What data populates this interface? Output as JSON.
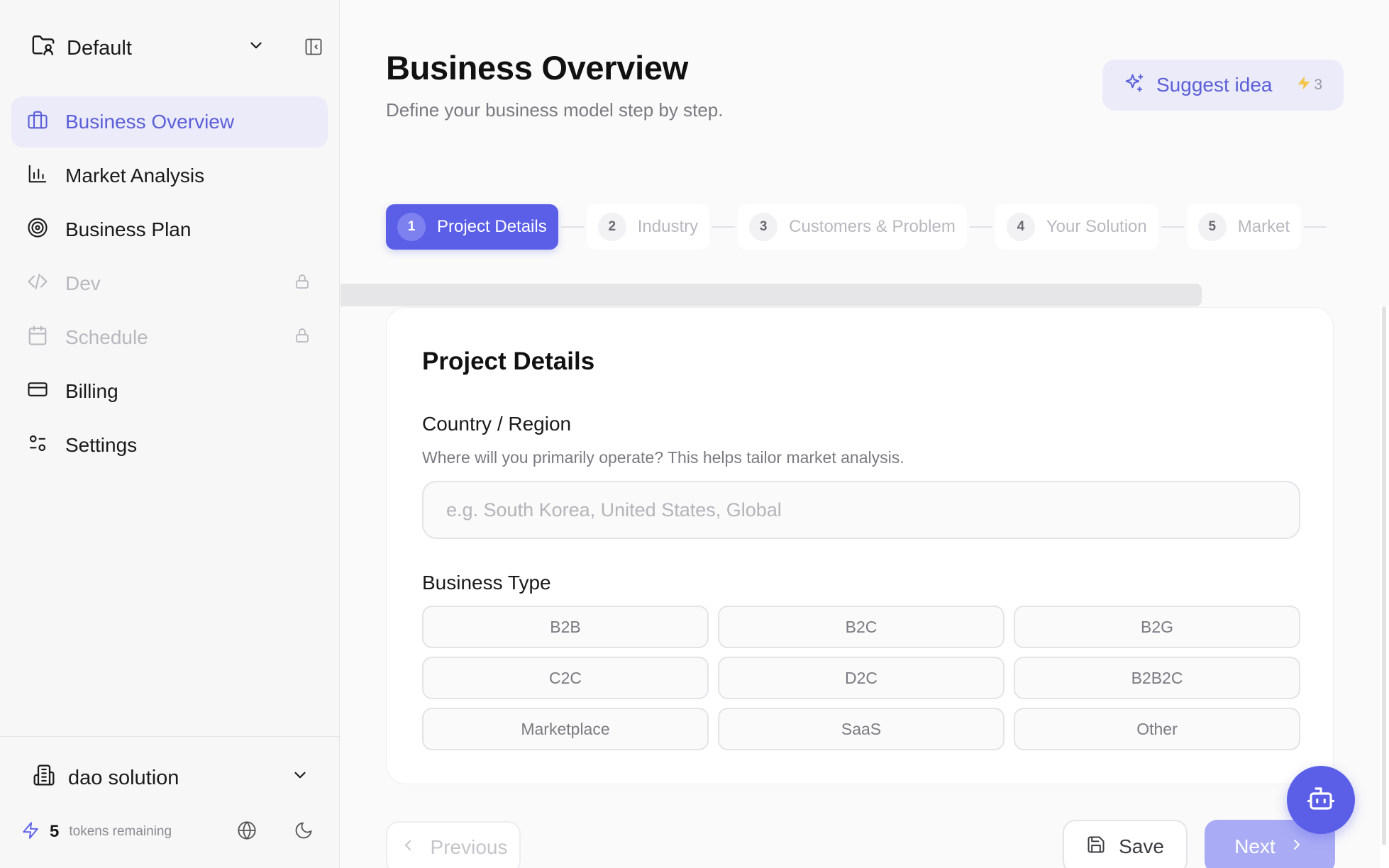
{
  "sidebar": {
    "workspace": "Default",
    "items": [
      {
        "label": "Business Overview",
        "icon": "briefcase-icon",
        "state": "active"
      },
      {
        "label": "Market Analysis",
        "icon": "bar-chart-icon",
        "state": "normal"
      },
      {
        "label": "Business Plan",
        "icon": "target-icon",
        "state": "normal"
      },
      {
        "label": "Dev",
        "icon": "code-icon",
        "state": "locked"
      },
      {
        "label": "Schedule",
        "icon": "calendar-icon",
        "state": "locked"
      },
      {
        "label": "Billing",
        "icon": "credit-card-icon",
        "state": "normal"
      },
      {
        "label": "Settings",
        "icon": "sliders-icon",
        "state": "normal"
      }
    ],
    "org": "dao solution",
    "tokens_count": "5",
    "tokens_label": "tokens remaining"
  },
  "header": {
    "title": "Business Overview",
    "subtitle": "Define your business model step by step.",
    "suggest_label": "Suggest idea",
    "suggest_count": "3"
  },
  "steps": [
    {
      "num": "1",
      "label": "Project Details",
      "active": true
    },
    {
      "num": "2",
      "label": "Industry",
      "active": false
    },
    {
      "num": "3",
      "label": "Customers & Problem",
      "active": false
    },
    {
      "num": "4",
      "label": "Your Solution",
      "active": false
    },
    {
      "num": "5",
      "label": "Market",
      "active": false
    }
  ],
  "form": {
    "card_title": "Project Details",
    "country_label": "Country / Region",
    "country_help": "Where will you primarily operate? This helps tailor market analysis.",
    "country_value": "",
    "country_placeholder": "e.g. South Korea, United States, Global",
    "business_type_label": "Business Type",
    "business_types": [
      "B2B",
      "B2C",
      "B2G",
      "C2C",
      "D2C",
      "B2B2C",
      "Marketplace",
      "SaaS",
      "Other"
    ]
  },
  "footer_buttons": {
    "previous": "Previous",
    "save": "Save",
    "next": "Next"
  },
  "colors": {
    "accent": "#5b5fe8",
    "accent_soft": "#ebebf9",
    "bolt": "#f5c44a"
  }
}
